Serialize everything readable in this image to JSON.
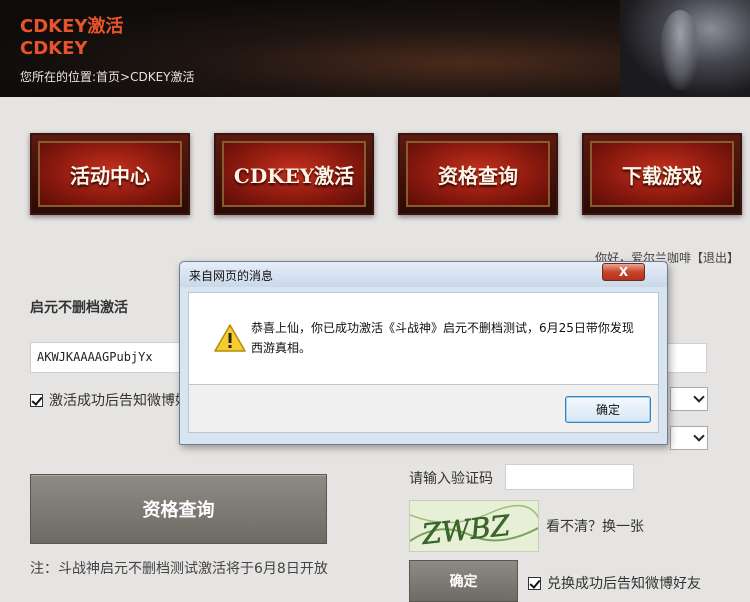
{
  "header": {
    "title": "CDKEY激活",
    "subtitle": "CDKEY",
    "breadcrumb": "您所在的位置:首页>CDKEY激活"
  },
  "nav": [
    {
      "label": "活动中心"
    },
    {
      "label": "CDKEY激活"
    },
    {
      "label": "资格查询"
    },
    {
      "label": "下载游戏"
    }
  ],
  "user_line": "你好，爱尔兰咖啡【退出】",
  "left_form": {
    "section_title": "启元不删档激活",
    "code_value": "AKWJKAAAAGPubjYx",
    "checkbox_label": "激活成功后告知微博好友",
    "checkbox_checked": true,
    "query_button": "资格查询",
    "note": "注：斗战神启元不删档测试激活将于6月8日开放"
  },
  "right_form": {
    "verify_label": "请输入验证码",
    "verify_value": "",
    "captcha_text": "ZWBZ",
    "refresh_link": "看不清？换一张",
    "confirm_button": "确定",
    "checkbox_label": "兑换成功后告知微博好友",
    "checkbox_checked": true
  },
  "dialog": {
    "title": "来自网页的消息",
    "close_label": "X",
    "message": "恭喜上仙，你已成功激活《斗战神》启元不删档测试，6月25日带你发现西游真相。",
    "ok_button": "确定",
    "icon": "warning-icon"
  },
  "colors": {
    "header_title": "#e8542a",
    "nav_red": "#a82314",
    "gray_button": "#7e7a74",
    "page_bg": "#e6e4e2"
  }
}
